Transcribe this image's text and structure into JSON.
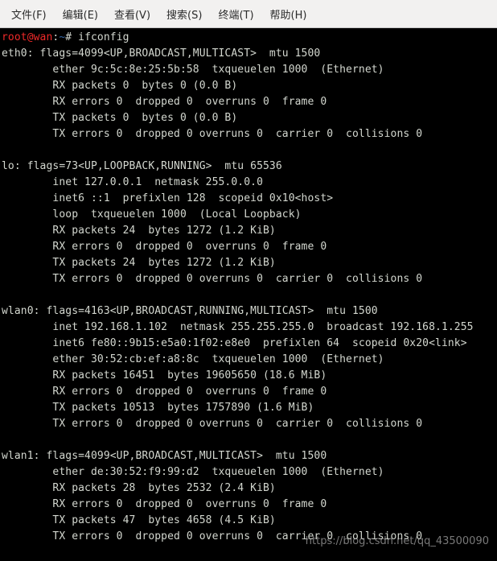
{
  "menubar": {
    "items": [
      {
        "label": "文件(F)"
      },
      {
        "label": "编辑(E)"
      },
      {
        "label": "查看(V)"
      },
      {
        "label": "搜索(S)"
      },
      {
        "label": "终端(T)"
      },
      {
        "label": "帮助(H)"
      }
    ]
  },
  "prompt": {
    "user_host": "root@wan",
    "sep": ":",
    "cwd": "~",
    "end": "# ",
    "command": "ifconfig"
  },
  "output": {
    "lines": [
      "eth0: flags=4099<UP,BROADCAST,MULTICAST>  mtu 1500",
      "        ether 9c:5c:8e:25:5b:58  txqueuelen 1000  (Ethernet)",
      "        RX packets 0  bytes 0 (0.0 B)",
      "        RX errors 0  dropped 0  overruns 0  frame 0",
      "        TX packets 0  bytes 0 (0.0 B)",
      "        TX errors 0  dropped 0 overruns 0  carrier 0  collisions 0",
      "",
      "lo: flags=73<UP,LOOPBACK,RUNNING>  mtu 65536",
      "        inet 127.0.0.1  netmask 255.0.0.0",
      "        inet6 ::1  prefixlen 128  scopeid 0x10<host>",
      "        loop  txqueuelen 1000  (Local Loopback)",
      "        RX packets 24  bytes 1272 (1.2 KiB)",
      "        RX errors 0  dropped 0  overruns 0  frame 0",
      "        TX packets 24  bytes 1272 (1.2 KiB)",
      "        TX errors 0  dropped 0 overruns 0  carrier 0  collisions 0",
      "",
      "wlan0: flags=4163<UP,BROADCAST,RUNNING,MULTICAST>  mtu 1500",
      "        inet 192.168.1.102  netmask 255.255.255.0  broadcast 192.168.1.255",
      "        inet6 fe80::9b15:e5a0:1f02:e8e0  prefixlen 64  scopeid 0x20<link>",
      "        ether 30:52:cb:ef:a8:8c  txqueuelen 1000  (Ethernet)",
      "        RX packets 16451  bytes 19605650 (18.6 MiB)",
      "        RX errors 0  dropped 0  overruns 0  frame 0",
      "        TX packets 10513  bytes 1757890 (1.6 MiB)",
      "        TX errors 0  dropped 0 overruns 0  carrier 0  collisions 0",
      "",
      "wlan1: flags=4099<UP,BROADCAST,MULTICAST>  mtu 1500",
      "        ether de:30:52:f9:99:d2  txqueuelen 1000  (Ethernet)",
      "        RX packets 28  bytes 2532 (2.4 KiB)",
      "        RX errors 0  dropped 0  overruns 0  frame 0",
      "        TX packets 47  bytes 4658 (4.5 KiB)",
      "        TX errors 0  dropped 0 overruns 0  carrier 0  collisions 0"
    ]
  },
  "watermark": "https://blog.csdn.net/qq_43500090"
}
